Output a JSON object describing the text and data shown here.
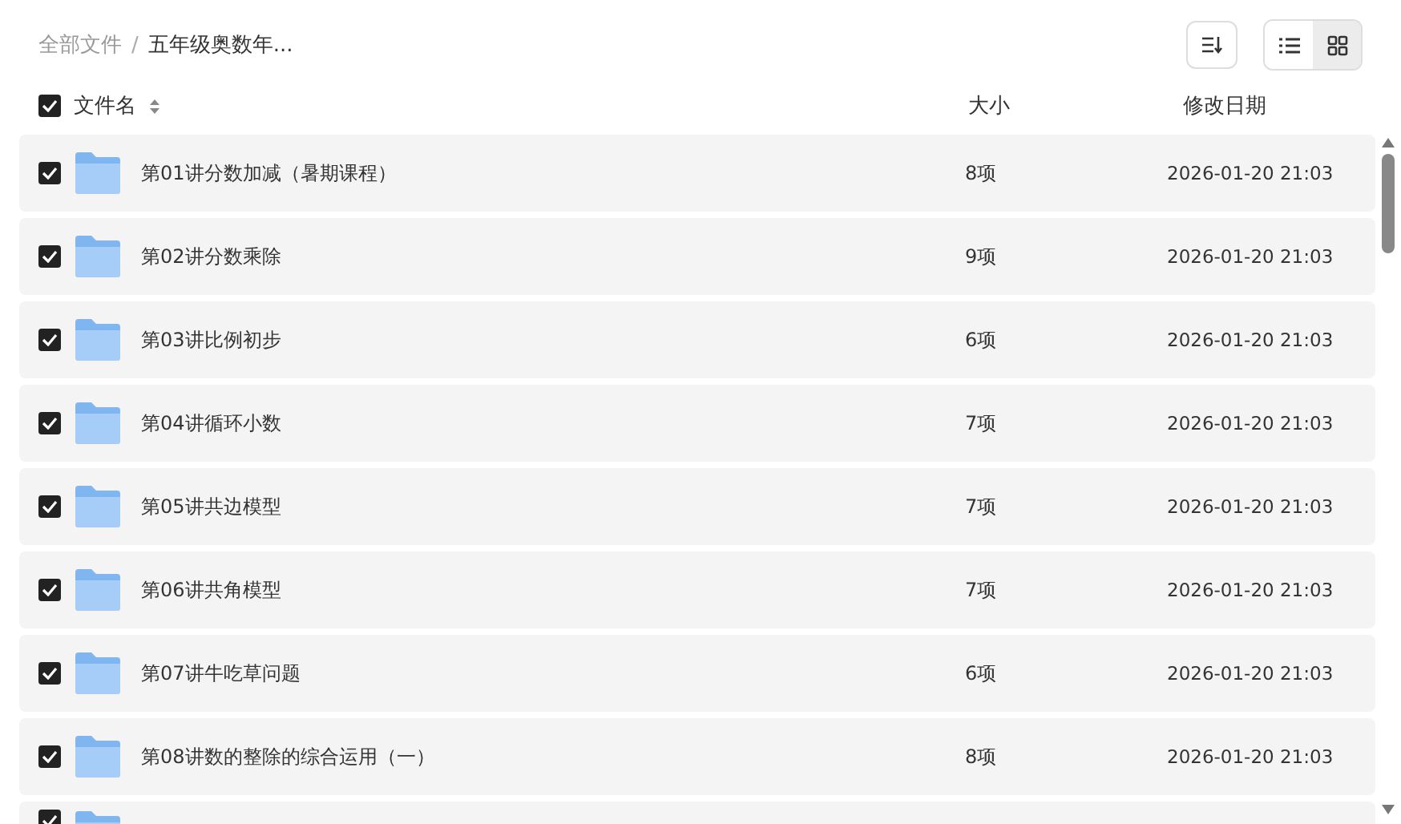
{
  "breadcrumb": [
    {
      "label": "全部文件",
      "current": false
    },
    {
      "label": "五年级奥数年...",
      "current": true
    }
  ],
  "breadcrumb_separator": "/",
  "toolbar": {
    "sort_icon": true,
    "views": [
      {
        "kind": "list",
        "selected": false
      },
      {
        "kind": "grid",
        "selected": true
      }
    ]
  },
  "header": {
    "checked": true,
    "columns": [
      "文件名",
      "大小",
      "修改日期"
    ]
  },
  "rows": [
    {
      "name": "第01讲分数加减（暑期课程）",
      "size": "8项",
      "date": "2026-01-20 21:03",
      "checked": true
    },
    {
      "name": "第02讲分数乘除",
      "size": "9项",
      "date": "2026-01-20 21:03",
      "checked": true
    },
    {
      "name": "第03讲比例初步",
      "size": "6项",
      "date": "2026-01-20 21:03",
      "checked": true
    },
    {
      "name": "第04讲循环小数",
      "size": "7项",
      "date": "2026-01-20 21:03",
      "checked": true
    },
    {
      "name": "第05讲共边模型",
      "size": "7项",
      "date": "2026-01-20 21:03",
      "checked": true
    },
    {
      "name": "第06讲共角模型",
      "size": "7项",
      "date": "2026-01-20 21:03",
      "checked": true
    },
    {
      "name": "第07讲牛吃草问题",
      "size": "6项",
      "date": "2026-01-20 21:03",
      "checked": true
    },
    {
      "name": "第08讲数的整除的综合运用（一）",
      "size": "8项",
      "date": "2026-01-20 21:03",
      "checked": true
    }
  ],
  "partial_row": {
    "checked": true
  }
}
